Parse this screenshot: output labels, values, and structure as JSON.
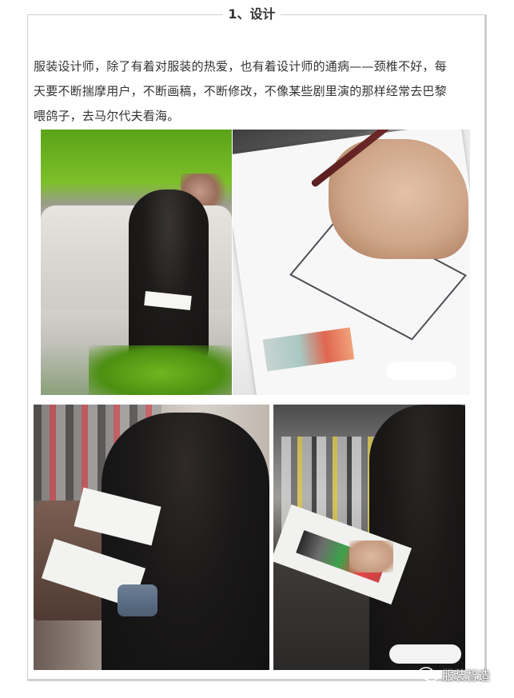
{
  "section": {
    "title": "1、设计"
  },
  "article": {
    "paragraph_line_1": "服装设计师，除了有着对服装的热爱，也有着设计师的通病——颈椎不好，每",
    "paragraph_line_2": "天要不断揣摩用户，不断画稿，不断修改，不像某些剧里演的那样经常去巴黎",
    "paragraph_line_3": "喂鸽子，去马尔代夫看海。"
  },
  "photos": [
    {
      "name": "designer-on-sofa-photo"
    },
    {
      "name": "hand-sketching-photo"
    },
    {
      "name": "designer-reading-photo"
    },
    {
      "name": "designer-swatch-photo"
    }
  ],
  "watermark": {
    "icon": "wechat-logo-icon",
    "text": "服装智造"
  },
  "colors": {
    "border": "#cfcfcf",
    "text": "#333333",
    "background": "#ffffff"
  }
}
